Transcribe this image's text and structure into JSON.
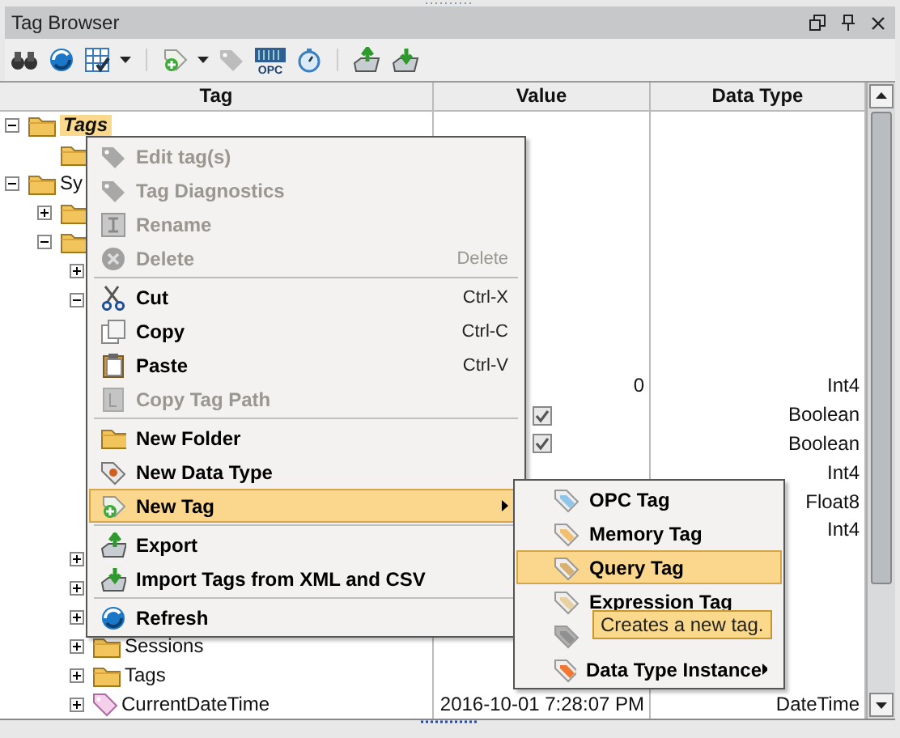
{
  "panel": {
    "title": "Tag Browser"
  },
  "toolbar": [
    {
      "kind": "binoculars",
      "disabled": false
    },
    {
      "kind": "globe",
      "disabled": false
    },
    {
      "kind": "grid",
      "disabled": false
    },
    {
      "kind": "caret",
      "disabled": false
    },
    {
      "kind": "sep"
    },
    {
      "kind": "tagadd",
      "disabled": false
    },
    {
      "kind": "caret",
      "disabled": false
    },
    {
      "kind": "tag",
      "disabled": true
    },
    {
      "kind": "opc",
      "label": "OPC",
      "disabled": false
    },
    {
      "kind": "stopwatch",
      "disabled": false
    },
    {
      "kind": "sep"
    },
    {
      "kind": "export",
      "disabled": false
    },
    {
      "kind": "import",
      "disabled": false
    }
  ],
  "table": {
    "columns": [
      "Tag",
      "Value",
      "Data Type"
    ],
    "tree": [
      {
        "kind": "folder",
        "label": "Tags",
        "selected": true,
        "expanded": true,
        "children": [
          {
            "kind": "folder",
            "selected": false
          }
        ]
      },
      {
        "kind": "folder",
        "label": "Sy",
        "selected": false,
        "expanded": true,
        "children": [
          {
            "kind": "folder",
            "selected": false,
            "expanded": false
          },
          {
            "kind": "folder",
            "selected": false,
            "expanded": true,
            "children": [
              {
                "selected": false,
                "expanded": false
              },
              {
                "selected": false,
                "expanded": true,
                "children": [
                  {
                    "selected": false
                  },
                  {
                    "selected": false
                  },
                  {
                    "selected": false,
                    "value": "0",
                    "data_type": "Int4"
                  },
                  {
                    "selected": false,
                    "checked": true,
                    "data_type": "Boolean"
                  },
                  {
                    "selected": false,
                    "checked": true,
                    "data_type": "Boolean"
                  },
                  {
                    "selected": false,
                    "data_type": "Int4"
                  },
                  {
                    "selected": false,
                    "data_type": "Float8"
                  },
                  {
                    "selected": false,
                    "data_type": "Int4"
                  }
                ]
              },
              {
                "selected": false,
                "expanded": false
              },
              {
                "selected": false,
                "expanded": false
              },
              {
                "selected": false,
                "expanded": false
              },
              {
                "kind": "folder",
                "label": "Sessions",
                "selected": false,
                "expanded": false
              },
              {
                "kind": "folder",
                "label": "Tags",
                "selected": false,
                "expanded": false
              },
              {
                "kind": "tag",
                "label": "CurrentDateTime",
                "selected": false,
                "expanded": false,
                "value": "2016-10-01 7:28:07 PM",
                "data_type": "DateTime"
              }
            ]
          }
        ]
      }
    ]
  },
  "context_menu": [
    {
      "kind": "item",
      "label": "Edit tag(s)",
      "disabled": true,
      "selected": false
    },
    {
      "kind": "item",
      "label": "Tag Diagnostics",
      "disabled": true,
      "selected": false
    },
    {
      "kind": "item",
      "label": "Rename",
      "disabled": true,
      "selected": false
    },
    {
      "kind": "item",
      "label": "Delete",
      "shortcut": "Delete",
      "disabled": true,
      "selected": false
    },
    {
      "kind": "sep"
    },
    {
      "kind": "item",
      "label": "Cut",
      "shortcut": "Ctrl-X",
      "disabled": false,
      "selected": false
    },
    {
      "kind": "item",
      "label": "Copy",
      "shortcut": "Ctrl-C",
      "disabled": false,
      "selected": false
    },
    {
      "kind": "item",
      "label": "Paste",
      "shortcut": "Ctrl-V",
      "disabled": false,
      "selected": false
    },
    {
      "kind": "item",
      "label": "Copy Tag Path",
      "disabled": true,
      "selected": false
    },
    {
      "kind": "sep"
    },
    {
      "kind": "item",
      "label": "New Folder",
      "disabled": false,
      "selected": false
    },
    {
      "kind": "item",
      "label": "New Data Type",
      "disabled": false,
      "selected": false
    },
    {
      "kind": "submenu",
      "label": "New Tag",
      "disabled": false,
      "selected": true
    },
    {
      "kind": "sep"
    },
    {
      "kind": "item",
      "label": "Export",
      "disabled": false,
      "selected": false
    },
    {
      "kind": "item",
      "label": "Import Tags from XML and CSV",
      "disabled": false,
      "selected": false
    },
    {
      "kind": "sep"
    },
    {
      "kind": "item",
      "label": "Refresh",
      "disabled": false,
      "selected": false
    }
  ],
  "submenu": [
    {
      "kind": "item",
      "label": "OPC Tag",
      "disabled": false,
      "selected": false
    },
    {
      "kind": "item",
      "label": "Memory Tag",
      "disabled": false,
      "selected": false
    },
    {
      "kind": "item",
      "label": "Query Tag",
      "disabled": false,
      "selected": true
    },
    {
      "kind": "item",
      "label": "Expression Tag",
      "disabled": false,
      "selected": false
    },
    {
      "kind": "item",
      "disabled": true,
      "selected": false
    },
    {
      "kind": "submenu",
      "label": "Data Type Instance",
      "disabled": false,
      "selected": false
    }
  ],
  "tooltip": "Creates a new tag."
}
